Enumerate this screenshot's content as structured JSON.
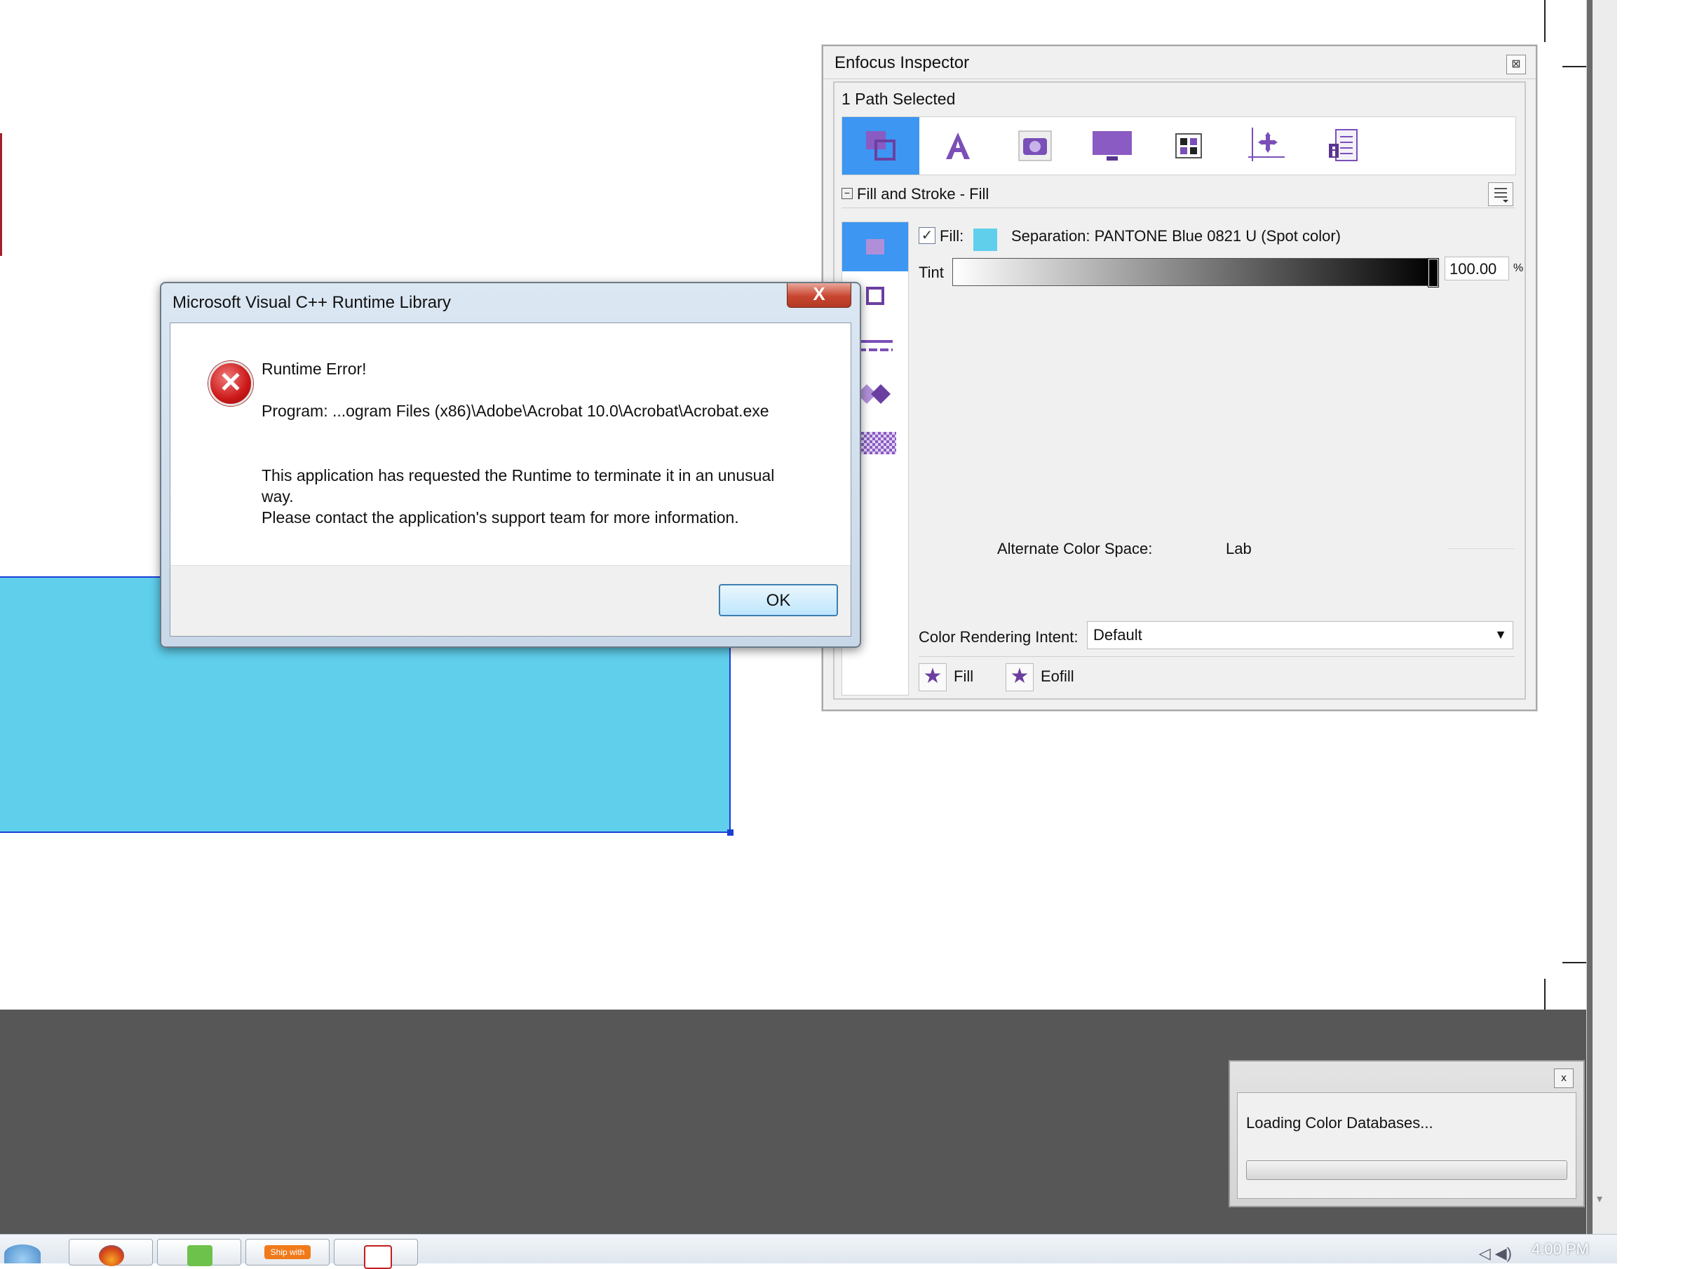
{
  "inspector": {
    "title": "Enfocus Inspector",
    "close_icon": "⊠",
    "path_selected": "1 Path Selected",
    "section_label": "Fill and Stroke - Fill",
    "fill_label": "Fill:",
    "fill_checked": true,
    "check_mark": "✓",
    "separation": "Separation: PANTONE Blue 0821 U (Spot color)",
    "tint_label": "Tint",
    "tint_value": "100.00",
    "tint_percent": "%",
    "alternate_label": "Alternate Color Space:",
    "alternate_value": "Lab",
    "rendering_intent_label": "Color Rendering Intent:",
    "rendering_intent_value": "Default",
    "dropdown_arrow": "▼",
    "fill_button_label": "Fill",
    "eofill_button_label": "Eofill",
    "star_glyph": "★",
    "tools": [
      "fill-stroke-icon",
      "text-icon",
      "camera-icon",
      "monitor-icon",
      "grid-icon",
      "position-icon",
      "document-info-icon"
    ],
    "fill_color": "#5fcfec",
    "accent_color": "#3c96f2",
    "icon_color": "#6b3fa0"
  },
  "dialog": {
    "title": "Microsoft Visual C++ Runtime Library",
    "close_glyph": "X",
    "error_glyph": "✕",
    "heading": "Runtime Error!",
    "program": "Program: ...ogram Files (x86)\\Adobe\\Acrobat 10.0\\Acrobat\\Acrobat.exe",
    "message_line1": "This application has requested the Runtime to terminate it in an unusual way.",
    "message_line2": "Please contact the application's support team for more information.",
    "ok_label": "OK"
  },
  "loading": {
    "text": "Loading Color Databases...",
    "close_glyph": "x"
  },
  "taskbar": {
    "clock": "4:00 PM",
    "apps": [
      "firefox-icon",
      "photos-icon",
      "ship-with-icon",
      "acrobat-icon"
    ],
    "ship_with_label": "Ship with"
  },
  "scrollbar": {
    "arrow": "▾"
  }
}
